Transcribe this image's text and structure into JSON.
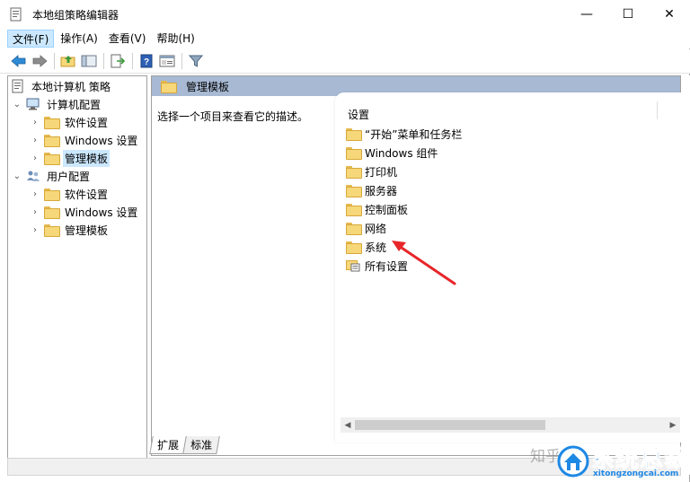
{
  "window": {
    "title": "本地组策略编辑器",
    "controls": {
      "minimize": "—",
      "maximize": "☐",
      "close": "✕"
    }
  },
  "menubar": {
    "items": [
      {
        "label": "文件(F)"
      },
      {
        "label": "操作(A)"
      },
      {
        "label": "查看(V)"
      },
      {
        "label": "帮助(H)"
      }
    ]
  },
  "toolbar": {
    "icons": [
      "back-arrow-icon",
      "forward-arrow-icon",
      "up-folder-icon",
      "show-hide-tree-icon",
      "export-list-icon",
      "help-icon",
      "properties-icon",
      "filter-icon"
    ]
  },
  "tree": {
    "root": "本地计算机 策略",
    "items": [
      {
        "label": "计算机配置"
      },
      {
        "label": "软件设置"
      },
      {
        "label": "Windows 设置"
      },
      {
        "label": "管理模板"
      },
      {
        "label": "用户配置"
      },
      {
        "label": "软件设置"
      },
      {
        "label": "Windows 设置"
      },
      {
        "label": "管理模板"
      }
    ]
  },
  "right_pane": {
    "header_title": "管理模板",
    "description": "选择一个项目来查看它的描述。",
    "list_header": "设置",
    "list_items": [
      {
        "label": "“开始”菜单和任务栏"
      },
      {
        "label": "Windows 组件"
      },
      {
        "label": "打印机"
      },
      {
        "label": "服务器"
      },
      {
        "label": "控制面板"
      },
      {
        "label": "网络"
      },
      {
        "label": "系统"
      },
      {
        "label": "所有设置"
      }
    ]
  },
  "tabs": [
    {
      "label": "扩展"
    },
    {
      "label": "标准"
    }
  ],
  "annotation": {
    "arrow_color": "#e8262a"
  },
  "watermark": {
    "zhihu": "知乎 @",
    "brand": "系统总裁",
    "url": "xitongzongcai.com"
  },
  "colors": {
    "header_bg": "#a7b9d3",
    "selection": "#cce8ff",
    "folder": "#f6d77a"
  }
}
